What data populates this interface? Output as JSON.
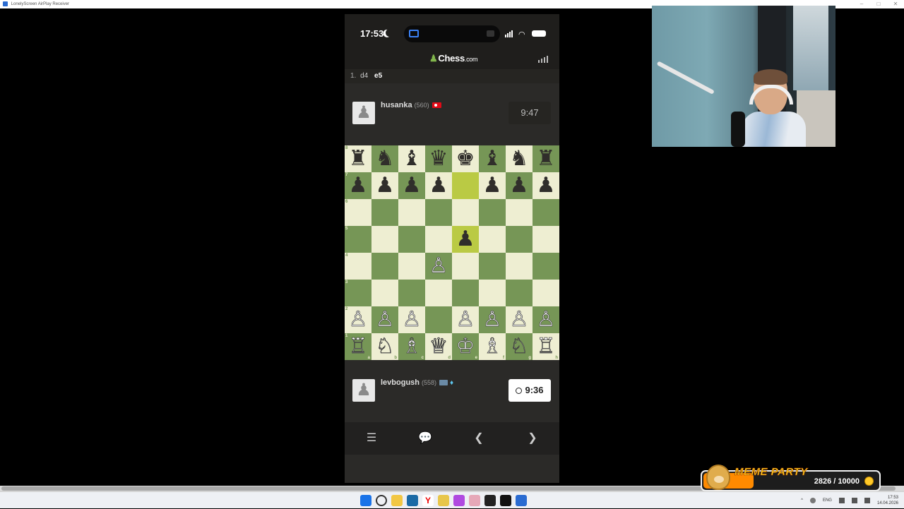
{
  "window": {
    "title": "LonelyScreen AirPlay Receiver"
  },
  "status_bar": {
    "time": "17:53"
  },
  "app": {
    "logo_text": "Chess",
    "logo_suffix": ".com"
  },
  "moves": {
    "number": "1.",
    "white": "d4",
    "black": "e5"
  },
  "opponent": {
    "name": "husanka",
    "rating": "(560)",
    "clock": "9:47",
    "flag_icon": "turkey-flag-icon"
  },
  "player": {
    "name": "levbogush",
    "rating": "(558)",
    "clock": "9:36",
    "badges": [
      "badge-icon",
      "diamond-icon"
    ]
  },
  "board": {
    "orientation": "white",
    "ranks": [
      [
        "♜",
        "♞",
        "♝",
        "♛",
        "♚",
        "♝",
        "♞",
        "♜"
      ],
      [
        "♟",
        "♟",
        "♟",
        "♟",
        "",
        "♟",
        "♟",
        "♟"
      ],
      [
        "",
        "",
        "",
        "",
        "",
        "",
        "",
        ""
      ],
      [
        "",
        "",
        "",
        "",
        "♟",
        "",
        "",
        ""
      ],
      [
        "",
        "",
        "",
        "♙",
        "",
        "",
        "",
        ""
      ],
      [
        "",
        "",
        "",
        "",
        "",
        "",
        "",
        ""
      ],
      [
        "♙",
        "♙",
        "♙",
        "",
        "♙",
        "♙",
        "♙",
        "♙"
      ],
      [
        "♖",
        "♘",
        "♗",
        "♕",
        "♔",
        "♗",
        "♘",
        "♖"
      ]
    ],
    "rank_labels": [
      "8",
      "7",
      "6",
      "5",
      "4",
      "3",
      "2",
      "1"
    ],
    "file_labels": [
      "a",
      "b",
      "c",
      "d",
      "e",
      "f",
      "g",
      "h"
    ],
    "highlighted": [
      "e7",
      "e5"
    ],
    "colors": {
      "light": "#eeeed2",
      "dark": "#769656",
      "highlight": "#baca44"
    }
  },
  "nav": {
    "icons": [
      "list-icon",
      "chat-icon",
      "previous-icon",
      "next-icon"
    ]
  },
  "overlay": {
    "title": "MEME PARTY",
    "count": "2826 / 10000",
    "progress": 0.2826
  },
  "taskbar": {
    "lang": "ENG",
    "time": "17:53",
    "date": "14.04.2026"
  }
}
